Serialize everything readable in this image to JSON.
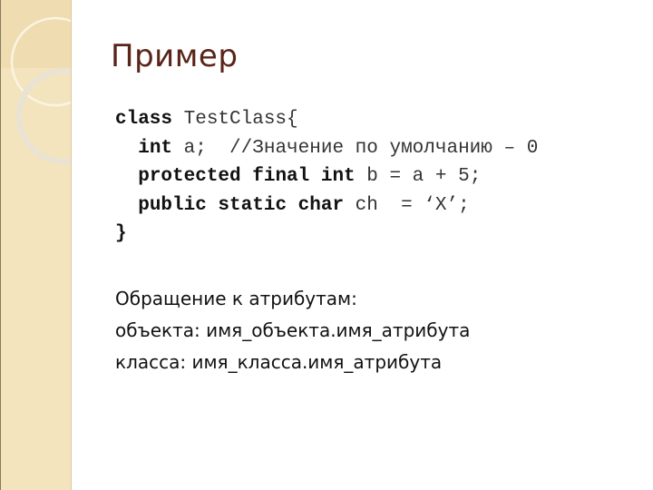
{
  "slide": {
    "title": "Пример",
    "code": {
      "line1": {
        "kw": "class",
        "rest": " TestClass{"
      },
      "line2": {
        "indent": "  ",
        "kw": "int",
        "rest": " a;  //Значение по умолчанию – 0"
      },
      "line3": {
        "indent": "  ",
        "kw": "protected final int",
        "rest": " b = a + 5;"
      },
      "line4": {
        "indent": "  ",
        "kw": "public static char",
        "rest": " ch  = ‘X’;"
      },
      "line5": {
        "text": "}"
      }
    },
    "body": {
      "line1": "Обращение к атрибутам:",
      "line2": "объекта: имя_объекта.имя_атрибута",
      "line3": "класса: имя_класса.имя_атрибута"
    }
  }
}
